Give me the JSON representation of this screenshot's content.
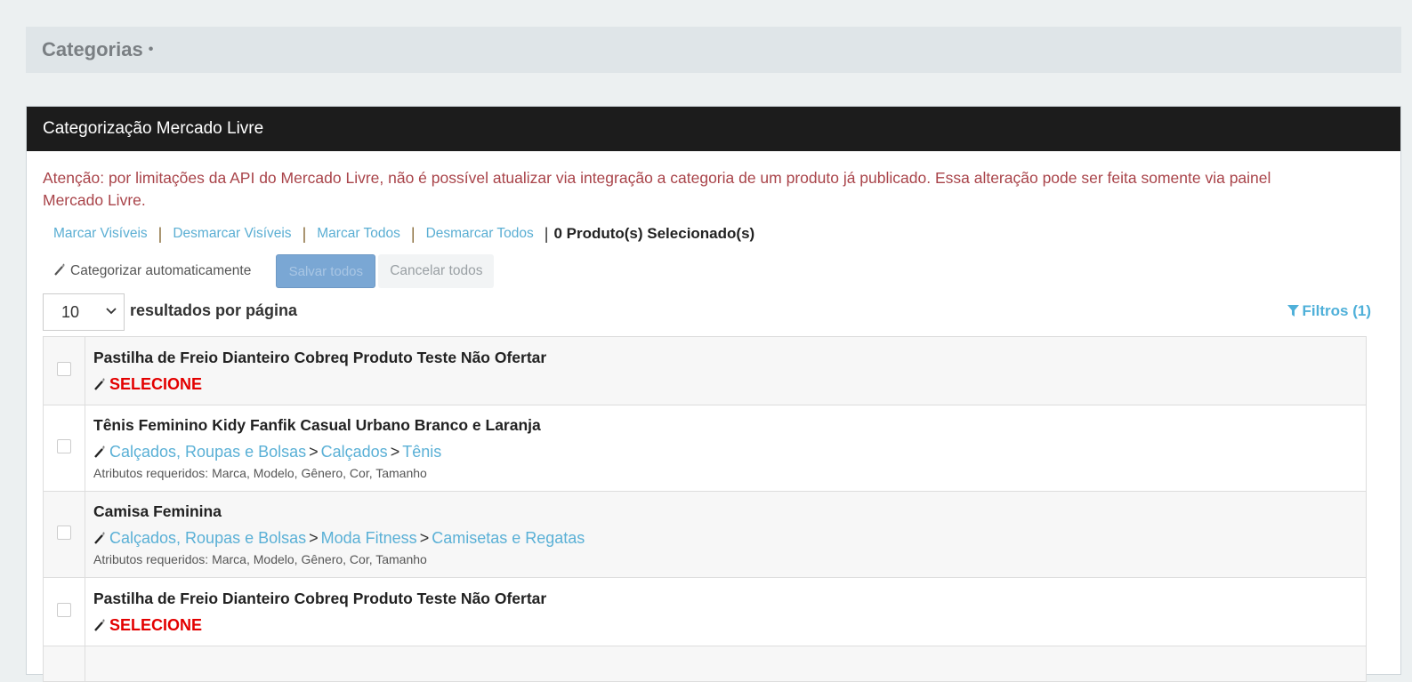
{
  "page": {
    "title": "Categorias",
    "title_dot": "•"
  },
  "panel": {
    "heading": "Categorização Mercado Livre",
    "alert": "Atenção: por limitações da API do Mercado Livre, não é possível atualizar via integração a categoria de um produto já publicado. Essa alteração pode ser feita somente via painel Mercado Livre."
  },
  "actions": {
    "mark_visible": "Marcar Visíveis",
    "unmark_visible": "Desmarcar Visíveis",
    "mark_all": "Marcar Todos",
    "unmark_all": "Desmarcar Todos",
    "selected_count": "0 Produto(s) Selecionado(s)",
    "separator": "|"
  },
  "buttons": {
    "auto_categorize": "Categorizar automaticamente",
    "save_all": "Salvar todos",
    "cancel_all": "Cancelar todos"
  },
  "pagination": {
    "per_page_value": "10",
    "per_page_label": "resultados por página"
  },
  "filters": {
    "label": "Filtros (1)"
  },
  "colors": {
    "link": "#5ab0d6",
    "alert": "#a9444a",
    "select_warning": "#e30000",
    "header_bg": "#1c1c1c"
  },
  "products": [
    {
      "name": "Pastilha de Freio Dianteiro Cobreq Produto Teste Não Ofertar",
      "selecione": "SELECIONE"
    },
    {
      "name": "Tênis Feminino Kidy Fanfik Casual Urbano Branco e Laranja",
      "categories": [
        "Calçados, Roupas e Bolsas",
        "Calçados",
        "Tênis"
      ],
      "attributes": "Atributos requeridos: Marca, Modelo, Gênero, Cor, Tamanho"
    },
    {
      "name": "Camisa Feminina",
      "categories": [
        "Calçados, Roupas e Bolsas",
        "Moda Fitness",
        "Camisetas e Regatas"
      ],
      "attributes": "Atributos requeridos: Marca, Modelo, Gênero, Cor, Tamanho"
    },
    {
      "name": "Pastilha de Freio Dianteiro Cobreq Produto Teste Não Ofertar",
      "selecione": "SELECIONE"
    }
  ],
  "category_separator": ">"
}
